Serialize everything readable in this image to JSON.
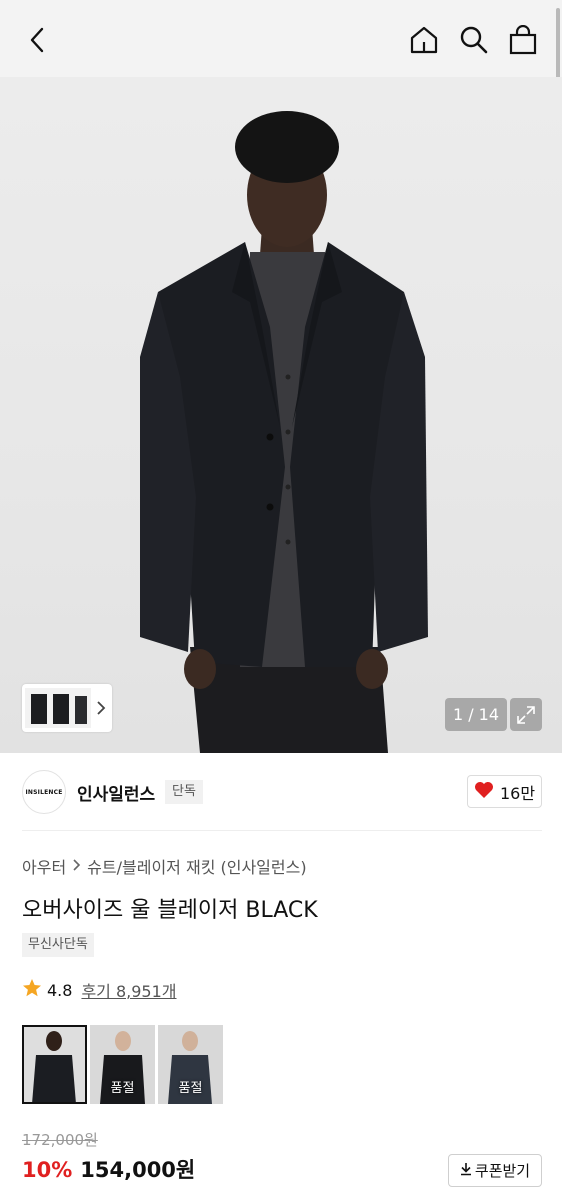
{
  "header": {
    "icons": [
      "back-arrow-icon",
      "home-icon",
      "search-icon",
      "shopping-bag-icon"
    ]
  },
  "gallery": {
    "counter": "1 / 14",
    "icons": [
      "chevron-right-icon",
      "expand-icon"
    ]
  },
  "brand": {
    "logo_text": "INSILENCE",
    "name": "인사일런스",
    "tag": "단독",
    "likes": "16만",
    "like_icon": "heart-icon",
    "like_color": "#e02020"
  },
  "product": {
    "breadcrumb": [
      "아우터",
      "슈트/블레이저 재킷 (인사일런스)"
    ],
    "title": "오버사이즈 울 블레이저 BLACK",
    "badge": "무신사단독",
    "rating": "4.8",
    "review_label": "후기 8,951개",
    "star_color": "#f5a623",
    "colors": [
      {
        "soldout": ""
      },
      {
        "soldout": "품절"
      },
      {
        "soldout": "품절"
      }
    ],
    "original_price": "172,000원",
    "discount": "10%",
    "sale_price": "154,000원",
    "discount_color": "#e02020",
    "coupon_label": "쿠폰받기"
  }
}
